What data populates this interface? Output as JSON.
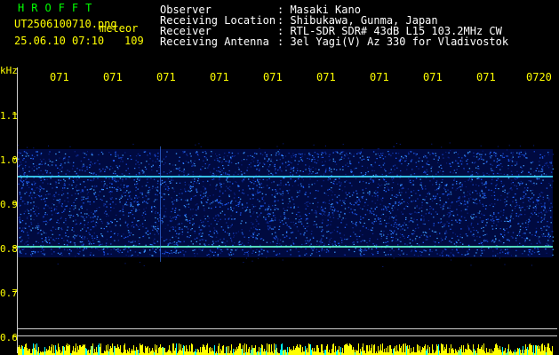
{
  "header": {
    "title": "HROFFT",
    "filename": "UT2506100710.png",
    "event_label": "meteor",
    "datetime": "25.06.10 07:10",
    "count": "109",
    "fields": [
      {
        "label": "Observer",
        "value": ": Masaki Kano"
      },
      {
        "label": "Receiving Location",
        "value": ": Shibukawa, Gunma, Japan"
      },
      {
        "label": "Receiver",
        "value": ": RTL-SDR SDR# 43dB L15 103.2MHz CW"
      },
      {
        "label": "Receiving Antenna",
        "value": ": 3el Yagi(V) Az 330 for Vladivostok"
      }
    ]
  },
  "axes": {
    "y_unit": "kHz",
    "y_ticks": [
      "1.1",
      "1.0",
      "0.9",
      "0.8",
      "0.7",
      "0.6"
    ],
    "x_ticks": [
      "071",
      "071",
      "071",
      "071",
      "071",
      "071",
      "071",
      "071",
      "071",
      "0720"
    ]
  },
  "colors": {
    "title": "#00ff00",
    "labels": "#ffffff",
    "axis": "#ffff00",
    "background": "#000000"
  }
}
